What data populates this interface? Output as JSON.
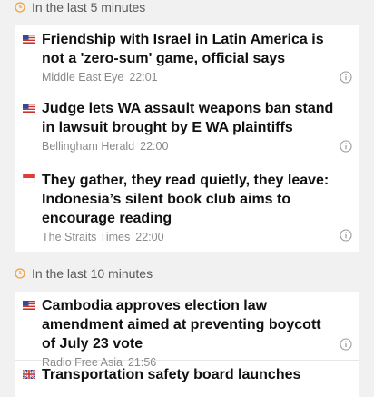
{
  "sections": [
    {
      "label": "In the last 5 minutes",
      "items": [
        {
          "flag": "us-flag-icon",
          "headline": "Friendship with Israel in Latin America is not a 'zero-sum' game, official says",
          "source": "Middle East Eye",
          "time": "22:01"
        },
        {
          "flag": "us-flag-icon",
          "headline": "Judge lets WA assault weapons ban stand in lawsuit brought by E WA plaintiffs",
          "source": "Bellingham Herald",
          "time": "22:00"
        },
        {
          "flag": "singapore-flag-icon",
          "headline": "They gather, they read quietly, they leave: Indonesia’s silent book club aims to encourage reading",
          "source": "The Straits Times",
          "time": "22:00"
        }
      ]
    },
    {
      "label": "In the last 10 minutes",
      "items": [
        {
          "flag": "us-flag-icon",
          "headline": "Cambodia approves election law amendment aimed at preventing boycott of July 23 vote",
          "source": "Radio Free Asia",
          "time": "21:56"
        },
        {
          "flag": "uk-flag-icon",
          "headline": "Transportation safety board launches",
          "source": "",
          "time": ""
        }
      ]
    }
  ],
  "colors": {
    "clock_accent": "#f0a23a",
    "background": "#f1f1f1"
  }
}
